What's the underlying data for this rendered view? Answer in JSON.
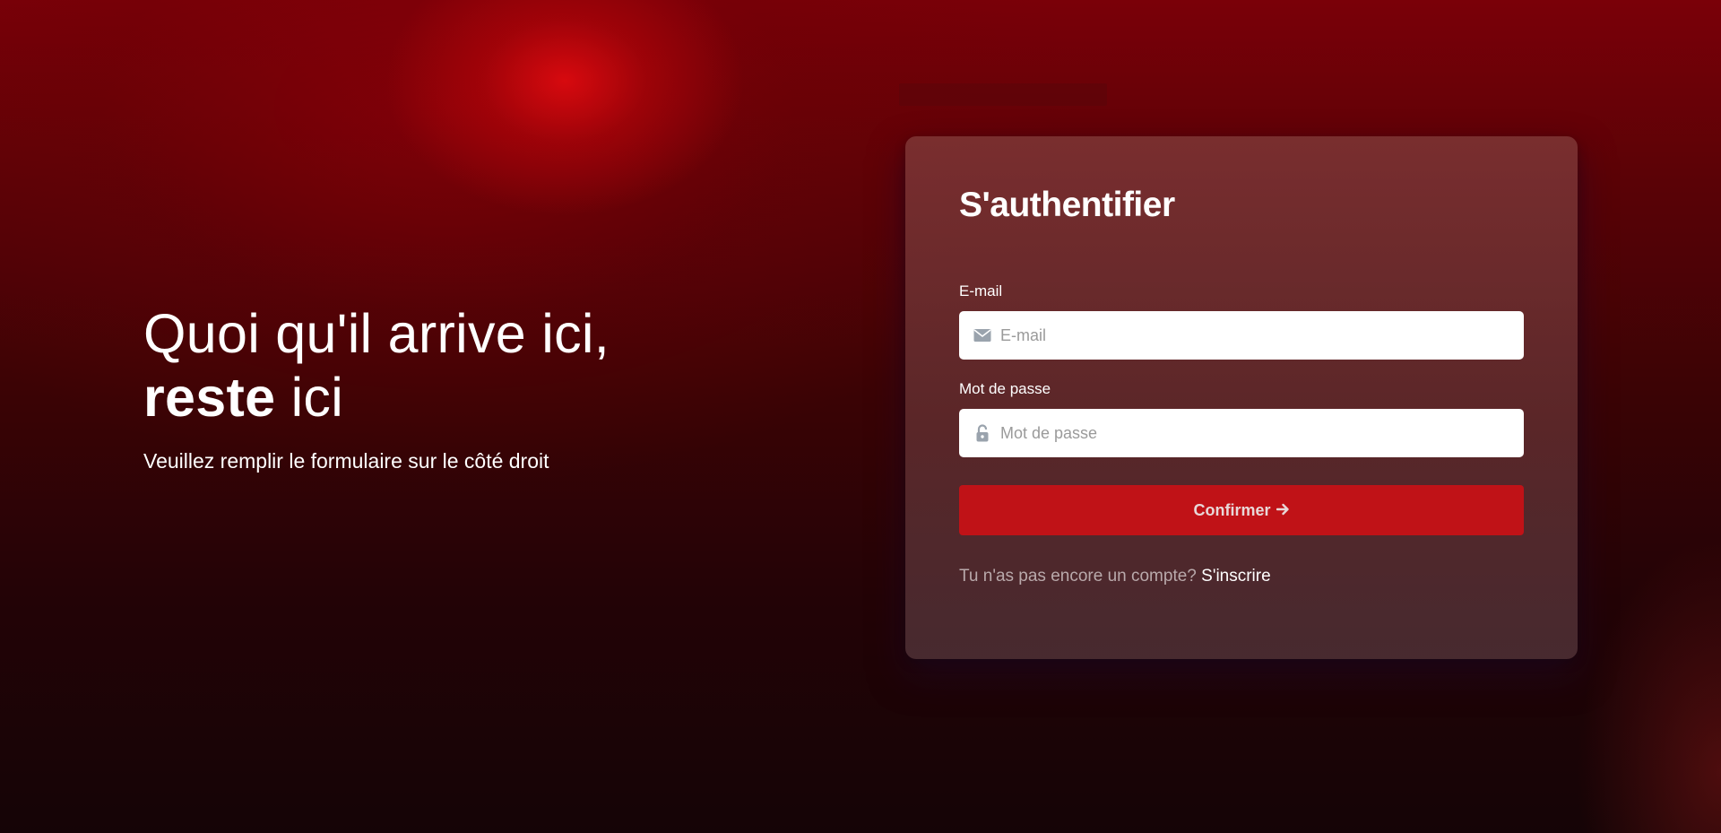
{
  "hero": {
    "line1": "Quoi qu'il arrive ici,",
    "line2_strong": "reste",
    "line2_rest": " ici",
    "subtitle": "Veuillez remplir le formulaire sur le côté droit"
  },
  "login": {
    "title": "S'authentifier",
    "email_label": "E-mail",
    "email_placeholder": "E-mail",
    "email_value": "",
    "password_label": "Mot de passe",
    "password_placeholder": "Mot de passe",
    "password_value": "",
    "submit_label": "Confirmer",
    "signup_prompt": "Tu n'as pas encore un compte? ",
    "signup_link": "S'inscrire"
  },
  "icons": {
    "email": "envelope-icon",
    "password": "lock-icon",
    "submit": "arrow-right-icon"
  },
  "colors": {
    "accent": "#c01217",
    "card_bg": "#7a3a3a",
    "background_dark": "#1a0506"
  }
}
